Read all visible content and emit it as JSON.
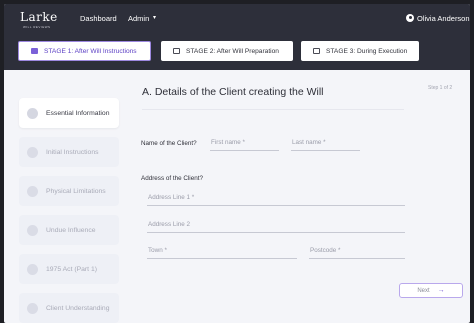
{
  "navbar": {
    "logo": "Larke",
    "logo_sub": "WILL REVIEWS",
    "links": [
      "Dashboard",
      "Admin"
    ],
    "admin_caret": "▾",
    "user": "Olivia Anderson"
  },
  "stages": [
    {
      "label": "STAGE 1:  After Will Instructions",
      "active": true
    },
    {
      "label": "STAGE 2:  After Will Preparation",
      "active": false
    },
    {
      "label": "STAGE 3:  During Execution",
      "active": false
    }
  ],
  "sidebar": {
    "items": [
      {
        "label": "Essential Information",
        "active": true
      },
      {
        "label": "Initial Instructions",
        "active": false
      },
      {
        "label": "Physical Limitations",
        "active": false
      },
      {
        "label": "Undue Influence",
        "active": false
      },
      {
        "label": "1975 Act (Part 1)",
        "active": false
      },
      {
        "label": "Client Understanding",
        "active": false
      }
    ]
  },
  "main": {
    "title": "A. Details of the Client creating the Will",
    "step": "Step 1 of 2",
    "name_label": "Name of the Client?",
    "first_name_placeholder": "First name *",
    "last_name_placeholder": "Last name *",
    "address_label": "Address of the Client?",
    "address1_placeholder": "Address Line 1 *",
    "address2_placeholder": "Address Line 2",
    "town_placeholder": "Town *",
    "postcode_placeholder": "Postcode *",
    "next_label": "Next",
    "next_arrow": "→"
  },
  "colors": {
    "accent": "#7b61d8",
    "navbar": "#2d2f3a",
    "background": "#f4f5f9"
  }
}
